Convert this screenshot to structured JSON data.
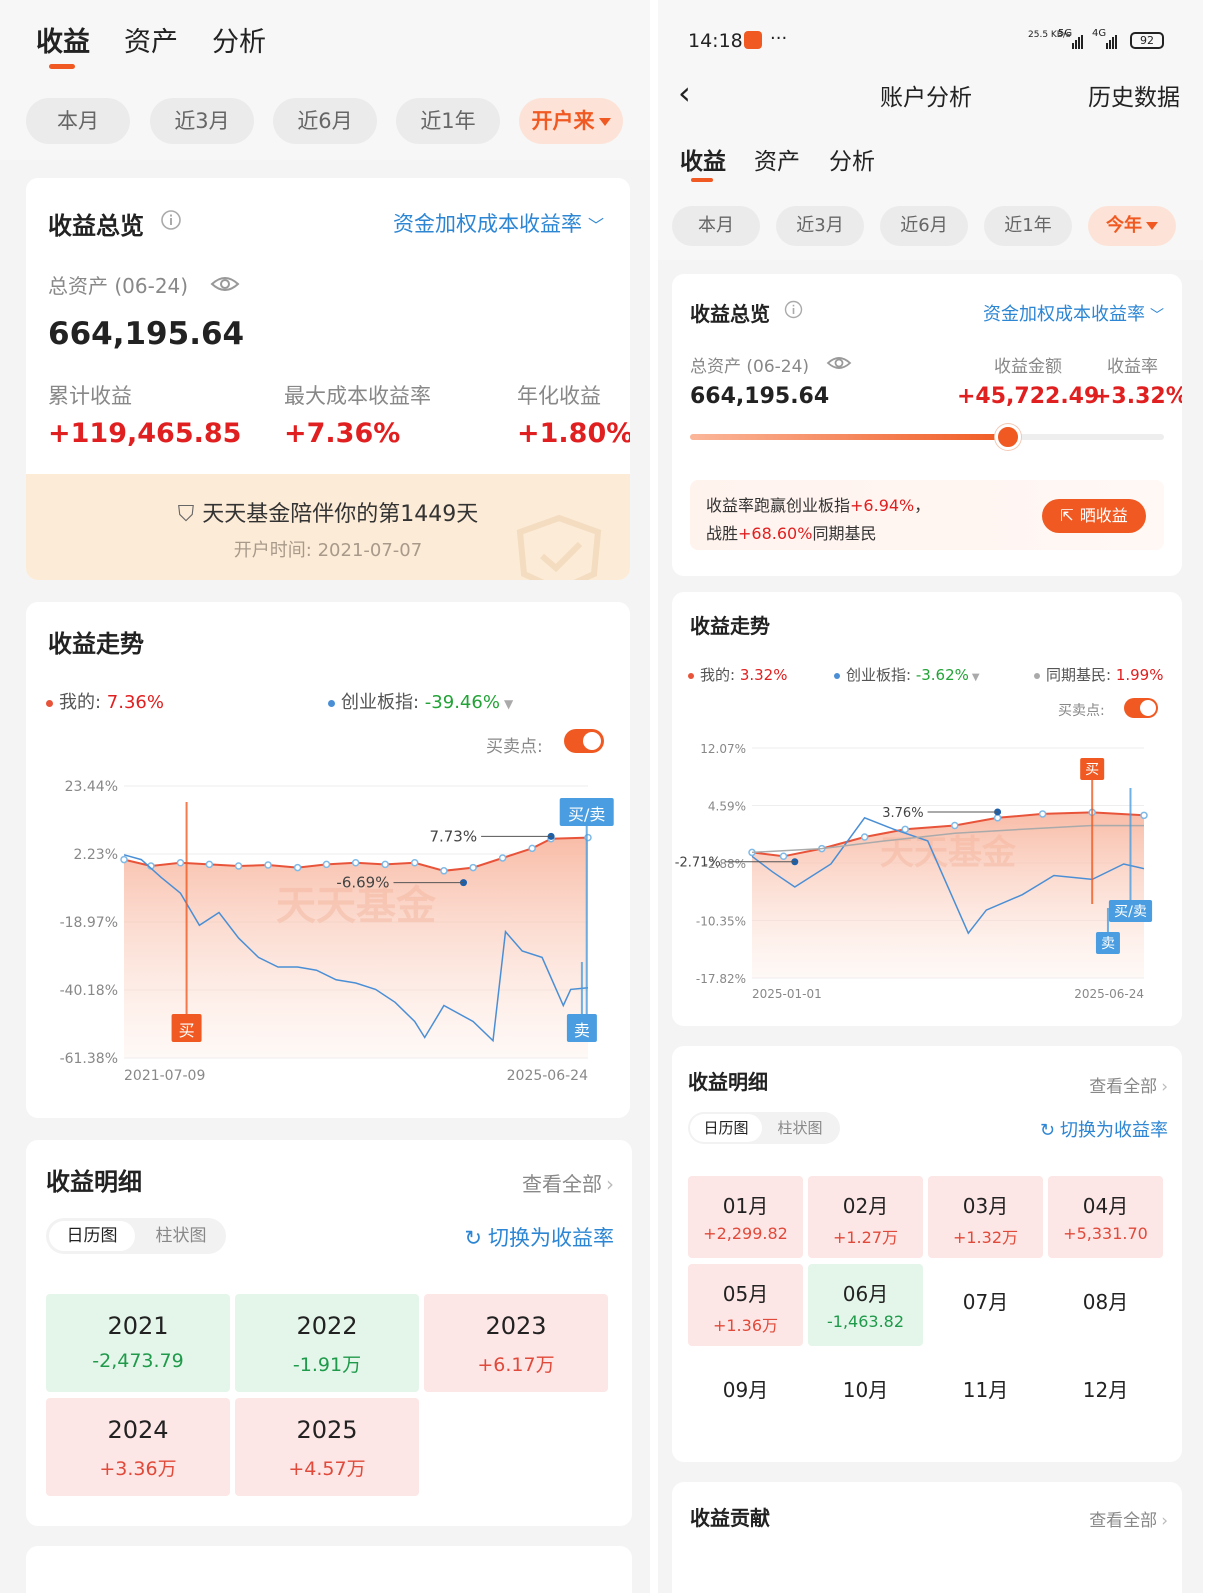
{
  "left": {
    "tabs": [
      "收益",
      "资产",
      "分析"
    ],
    "periods": [
      "本月",
      "近3月",
      "近6月",
      "近1年",
      "开户来"
    ],
    "overview": {
      "title": "收益总览",
      "rate_mode": "资金加权成本收益率",
      "total_assets_label": "总资产 (06-24)",
      "total_assets": "664,195.64",
      "cumulative_label": "累计收益",
      "cumulative": "+119,465.85",
      "max_rate_label": "最大成本收益率",
      "max_rate": "+7.36%",
      "annual_label": "年化收益",
      "annual": "+1.80%",
      "companion": "天天基金陪伴你的第1449天",
      "open_date": "开户时间: 2021-07-07"
    },
    "trend": {
      "title": "收益走势",
      "legend_mine_label": "我的: ",
      "legend_mine_value": "7.36%",
      "legend_index_label": "创业板指: ",
      "legend_index_value": "-39.46%",
      "bs_label": "买卖点:",
      "watermark": "天天基金",
      "buy_tag": "买",
      "sell_tag": "卖",
      "buysell_tag": "买/卖"
    },
    "detail": {
      "title": "收益明细",
      "view_all": "查看全部",
      "seg_calendar": "日历图",
      "seg_bar": "柱状图",
      "switch": "切换为收益率",
      "years": [
        {
          "name": "2021",
          "value": "-2,473.79",
          "sign": "neg"
        },
        {
          "name": "2022",
          "value": "-1.91万",
          "sign": "neg"
        },
        {
          "name": "2023",
          "value": "+6.17万",
          "sign": "pos"
        },
        {
          "name": "2024",
          "value": "+3.36万",
          "sign": "pos"
        },
        {
          "name": "2025",
          "value": "+4.57万",
          "sign": "pos"
        }
      ]
    }
  },
  "right": {
    "status": {
      "time": "14:18",
      "more": "···",
      "net_speed": "25.5 KB/s",
      "net1": "5G",
      "net2": "4G",
      "battery": "92"
    },
    "nav": {
      "title": "账户分析",
      "history": "历史数据"
    },
    "tabs": [
      "收益",
      "资产",
      "分析"
    ],
    "periods": [
      "本月",
      "近3月",
      "近6月",
      "近1年",
      "今年"
    ],
    "overview": {
      "title": "收益总览",
      "rate_mode": "资金加权成本收益率",
      "total_assets_label": "总资产 (06-24)",
      "total_assets": "664,195.64",
      "amount_label": "收益金额",
      "amount": "+45,722.49",
      "rate_label": "收益率",
      "rate": "+3.32%",
      "progress": 0.67,
      "beat_pre": "收益率跑赢创业板指",
      "beat_value": "+6.94%",
      "beat_post": "，",
      "win_pre": "战胜",
      "win_value": "+68.60%",
      "win_post": "同期基民",
      "share_btn": "晒收益"
    },
    "trend": {
      "title": "收益走势",
      "legend_mine_label": "我的: ",
      "legend_mine_value": "3.32%",
      "legend_index_label": "创业板指: ",
      "legend_index_value": "-3.62%",
      "legend_peer_label": "同期基民: ",
      "legend_peer_value": "1.99%",
      "bs_label": "买卖点:",
      "watermark": "天天基金",
      "buy_tag": "买",
      "sell_tag": "卖",
      "buysell_tag": "买/卖"
    },
    "detail": {
      "title": "收益明细",
      "view_all": "查看全部",
      "seg_calendar": "日历图",
      "seg_bar": "柱状图",
      "switch": "切换为收益率",
      "months": [
        {
          "name": "01月",
          "value": "+2,299.82",
          "sign": "pos"
        },
        {
          "name": "02月",
          "value": "+1.27万",
          "sign": "pos"
        },
        {
          "name": "03月",
          "value": "+1.32万",
          "sign": "pos"
        },
        {
          "name": "04月",
          "value": "+5,331.70",
          "sign": "pos"
        },
        {
          "name": "05月",
          "value": "+1.36万",
          "sign": "pos"
        },
        {
          "name": "06月",
          "value": "-1,463.82",
          "sign": "neg"
        },
        {
          "name": "07月",
          "value": "",
          "sign": "none"
        },
        {
          "name": "08月",
          "value": "",
          "sign": "none"
        },
        {
          "name": "09月",
          "value": "",
          "sign": "none"
        },
        {
          "name": "10月",
          "value": "",
          "sign": "none"
        },
        {
          "name": "11月",
          "value": "",
          "sign": "none"
        },
        {
          "name": "12月",
          "value": "",
          "sign": "none"
        }
      ]
    },
    "contribution": {
      "title": "收益贡献",
      "view_all": "查看全部"
    }
  },
  "chart_data": [
    {
      "type": "line",
      "title": "收益走势",
      "x_range": [
        "2021-07-09",
        "2025-06-24"
      ],
      "y_ticks": [
        "23.44%",
        "2.23%",
        "-18.97%",
        "-40.18%",
        "-61.38%"
      ],
      "ylim": [
        -61.38,
        23.44
      ],
      "annotations": [
        {
          "text": "7.73%",
          "date": "2025-03",
          "y": 7.73
        },
        {
          "text": "-6.69%",
          "date": "2024-06",
          "y": -6.69
        }
      ],
      "series": [
        {
          "name": "我的",
          "color": "#e8543a",
          "x": [
            "2021-07-09",
            "2021-10-01",
            "2022-01-01",
            "2022-04-01",
            "2022-07-01",
            "2022-10-01",
            "2023-01-01",
            "2023-04-01",
            "2023-07-01",
            "2023-10-01",
            "2024-01-01",
            "2024-04-01",
            "2024-07-01",
            "2024-10-01",
            "2025-01-01",
            "2025-03-01",
            "2025-06-24"
          ],
          "y": [
            0.5,
            -1.5,
            -0.5,
            -1.0,
            -1.5,
            -1.2,
            -2.0,
            -1.0,
            -0.5,
            -1.0,
            -0.5,
            -3.0,
            -2.0,
            1.0,
            4.0,
            7.0,
            7.36
          ]
        },
        {
          "name": "创业板指",
          "color": "#4a8fd6",
          "x": [
            "2021-07-09",
            "2021-09-01",
            "2021-11-01",
            "2022-01-01",
            "2022-03-01",
            "2022-05-01",
            "2022-07-01",
            "2022-09-01",
            "2022-11-01",
            "2023-01-01",
            "2023-03-01",
            "2023-05-01",
            "2023-07-01",
            "2023-09-01",
            "2023-11-01",
            "2024-01-01",
            "2024-02-01",
            "2024-04-01",
            "2024-07-01",
            "2024-09-01",
            "2024-10-10",
            "2024-12-01",
            "2025-02-01",
            "2025-04-08",
            "2025-05-01",
            "2025-06-24"
          ],
          "y": [
            2.0,
            0.5,
            -5.0,
            -10.0,
            -20.0,
            -16.0,
            -24.0,
            -30.0,
            -33.0,
            -33.0,
            -34.0,
            -37.0,
            -38.0,
            -40.0,
            -44.0,
            -50.0,
            -55.0,
            -45.0,
            -50.0,
            -56.0,
            -22.0,
            -28.0,
            -30.0,
            -45.0,
            -40.0,
            -39.46
          ]
        }
      ]
    },
    {
      "type": "line",
      "title": "收益走势",
      "x_range": [
        "2025-01-01",
        "2025-06-24"
      ],
      "y_ticks": [
        "12.07%",
        "4.59%",
        "-2.88%",
        "-10.35%",
        "-17.82%"
      ],
      "ylim": [
        -17.82,
        12.07
      ],
      "annotations": [
        {
          "text": "3.76%",
          "date": "2025-04-20",
          "y": 3.76
        },
        {
          "text": "-2.71%",
          "date": "2025-01-20",
          "y": -2.71
        }
      ],
      "series": [
        {
          "name": "我的",
          "color": "#e8543a",
          "x": [
            "2025-01-01",
            "2025-01-15",
            "2025-02-01",
            "2025-02-20",
            "2025-03-10",
            "2025-04-01",
            "2025-04-20",
            "2025-05-10",
            "2025-06-01",
            "2025-06-24"
          ],
          "y": [
            -1.5,
            -2.0,
            -1.0,
            0.5,
            1.5,
            2.0,
            3.0,
            3.5,
            3.7,
            3.32
          ]
        },
        {
          "name": "创业板指",
          "color": "#4a8fd6",
          "x": [
            "2025-01-01",
            "2025-01-10",
            "2025-01-20",
            "2025-02-05",
            "2025-02-20",
            "2025-03-05",
            "2025-03-20",
            "2025-04-07",
            "2025-04-15",
            "2025-05-01",
            "2025-05-15",
            "2025-06-01",
            "2025-06-15",
            "2025-06-24"
          ],
          "y": [
            -2.0,
            -4.0,
            -6.0,
            -3.0,
            3.0,
            1.5,
            0.0,
            -12.0,
            -9.0,
            -7.0,
            -4.5,
            -5.0,
            -3.0,
            -3.62
          ]
        },
        {
          "name": "同期基民",
          "color": "#aaaaaa",
          "x": [
            "2025-01-01",
            "2025-02-01",
            "2025-03-01",
            "2025-04-01",
            "2025-05-01",
            "2025-06-01",
            "2025-06-24"
          ],
          "y": [
            -1.5,
            -1.0,
            0.0,
            1.0,
            1.5,
            2.0,
            1.99
          ]
        }
      ]
    }
  ]
}
